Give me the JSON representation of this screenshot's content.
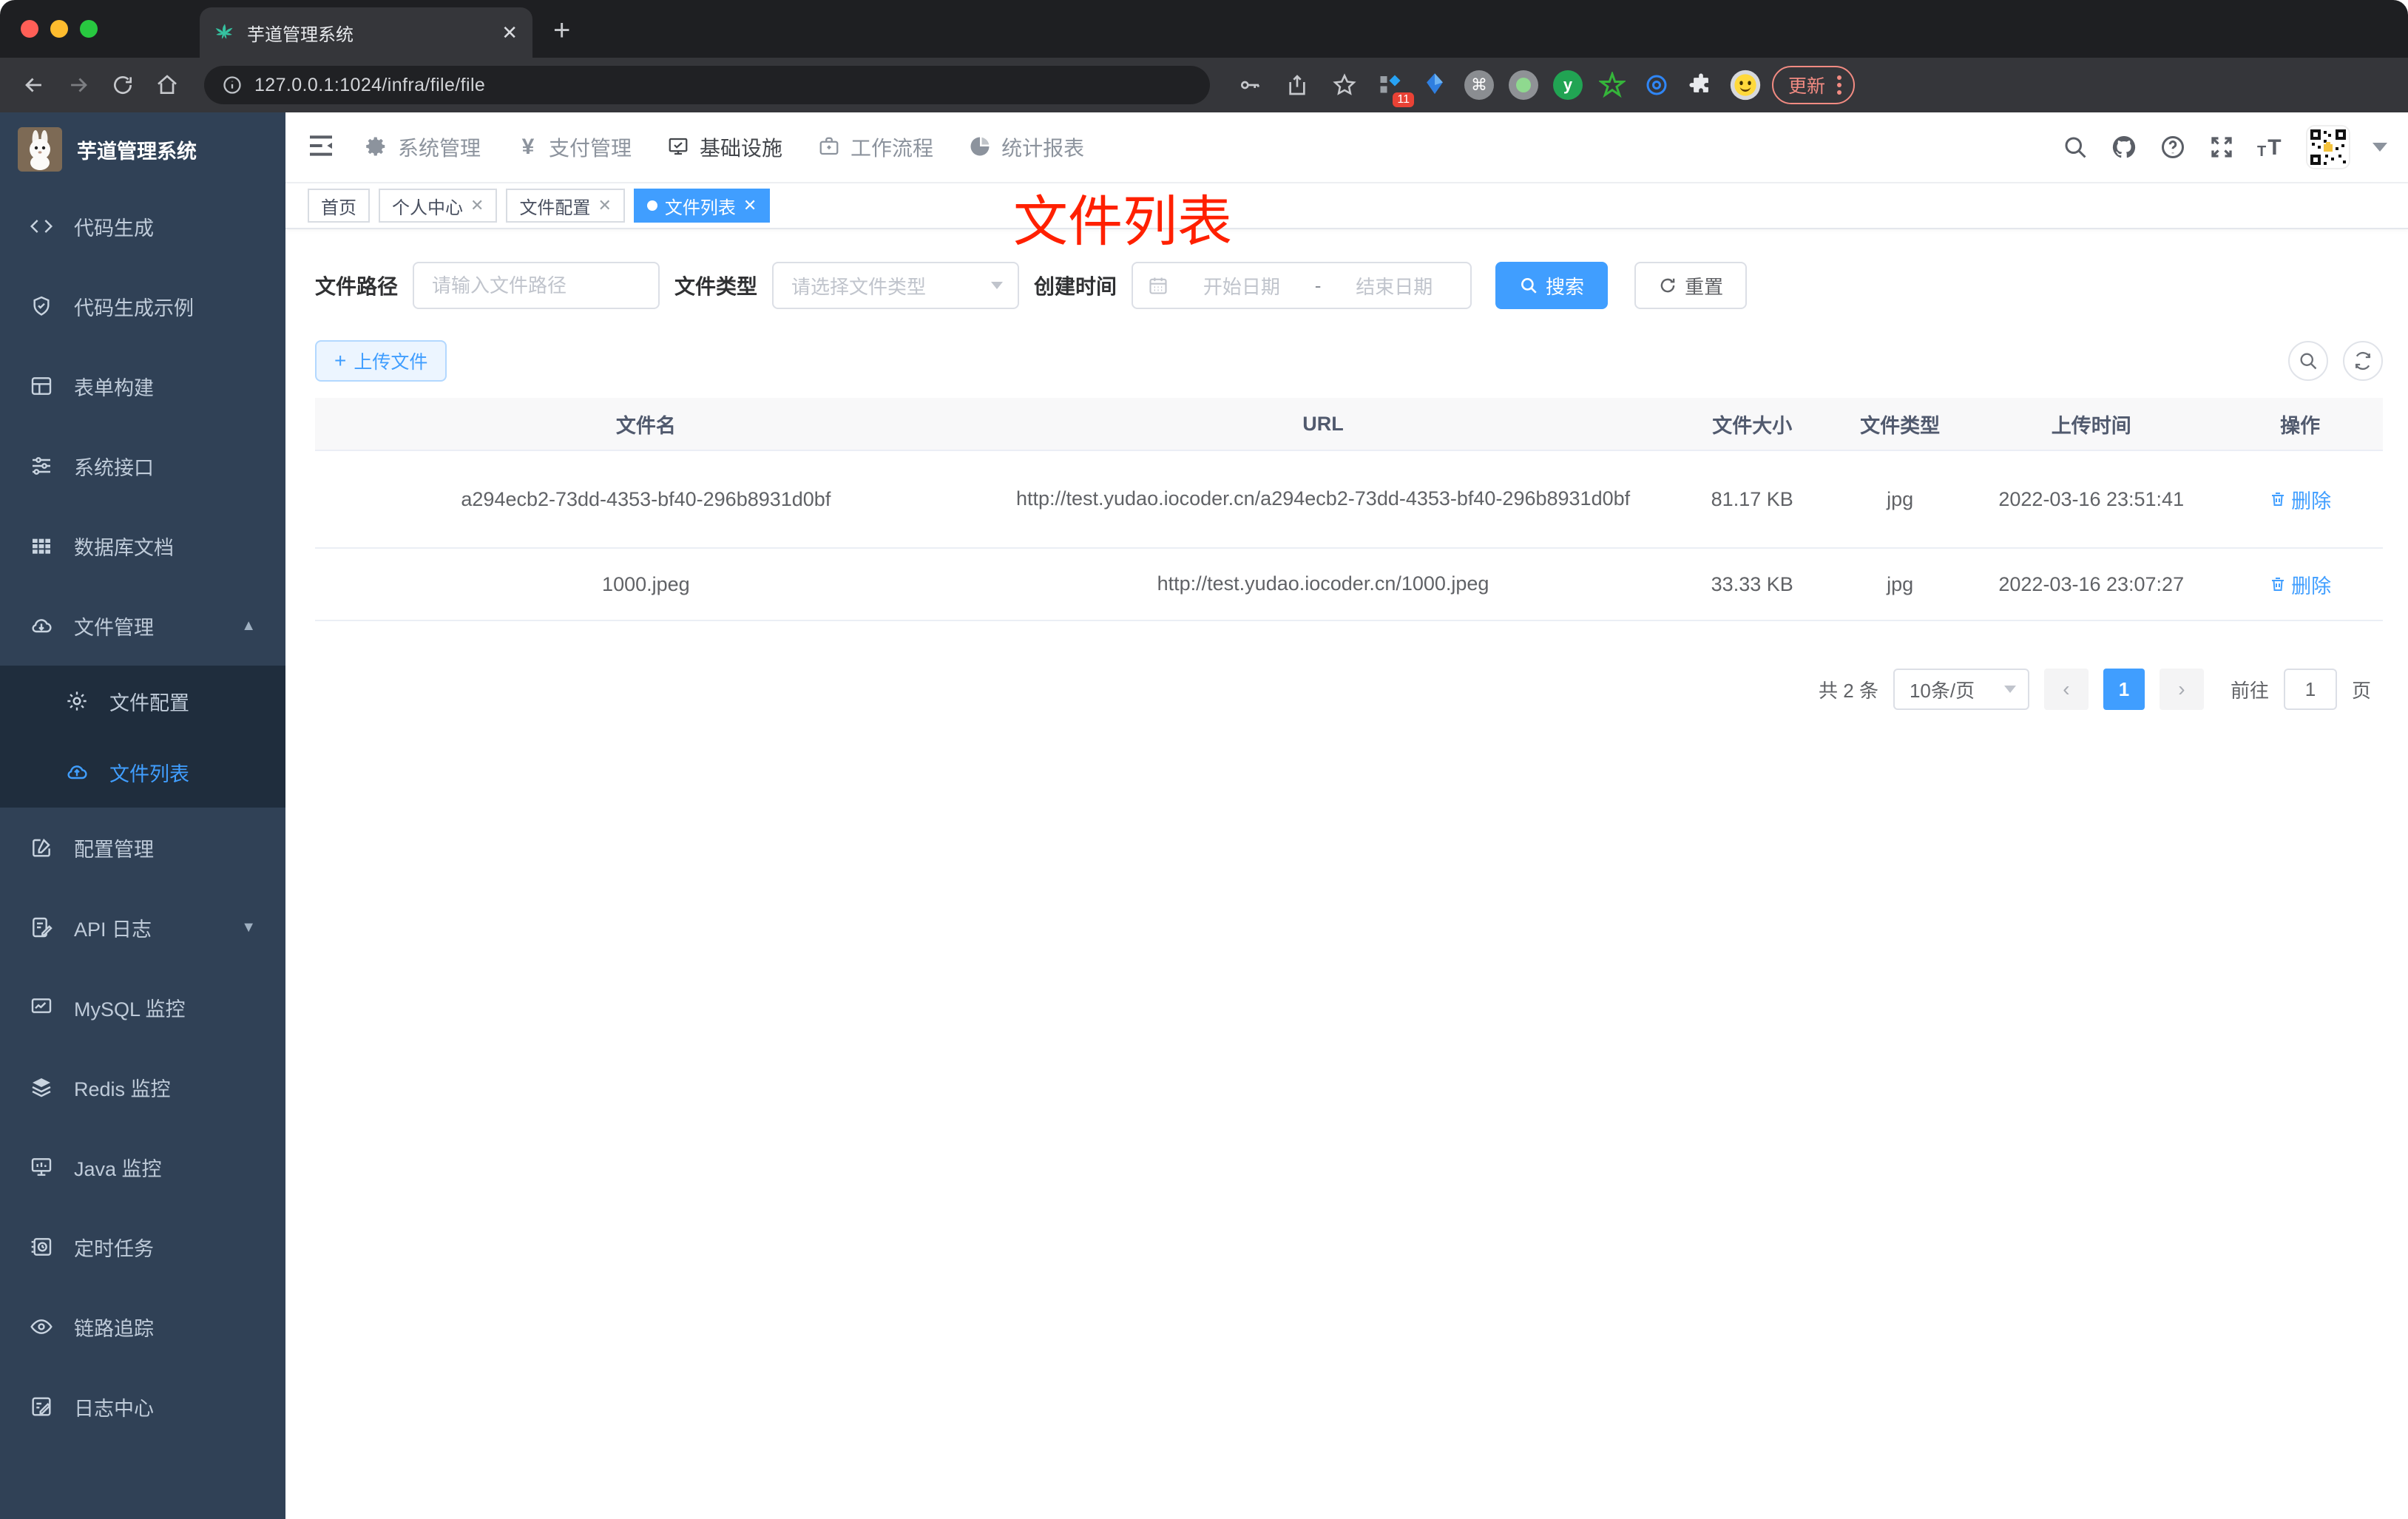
{
  "browser": {
    "tab_title": "芋道管理系统",
    "url": "127.0.0.1:1024/infra/file/file",
    "extension_badge": "11",
    "update_label": "更新"
  },
  "header": {
    "nav": [
      {
        "label": "系统管理"
      },
      {
        "label": "支付管理"
      },
      {
        "label": "基础设施"
      },
      {
        "label": "工作流程"
      },
      {
        "label": "统计报表"
      }
    ]
  },
  "sidebar": {
    "title": "芋道管理系统",
    "items": [
      {
        "label": "代码生成"
      },
      {
        "label": "代码生成示例"
      },
      {
        "label": "表单构建"
      },
      {
        "label": "系统接口"
      },
      {
        "label": "数据库文档"
      },
      {
        "label": "文件管理"
      },
      {
        "label": "文件配置"
      },
      {
        "label": "文件列表"
      },
      {
        "label": "配置管理"
      },
      {
        "label": "API 日志"
      },
      {
        "label": "MySQL 监控"
      },
      {
        "label": "Redis 监控"
      },
      {
        "label": "Java 监控"
      },
      {
        "label": "定时任务"
      },
      {
        "label": "链路追踪"
      },
      {
        "label": "日志中心"
      }
    ]
  },
  "tags": [
    {
      "label": "首页"
    },
    {
      "label": "个人中心"
    },
    {
      "label": "文件配置"
    },
    {
      "label": "文件列表"
    }
  ],
  "annotation": "文件列表",
  "filters": {
    "path_label": "文件路径",
    "path_placeholder": "请输入文件路径",
    "type_label": "文件类型",
    "type_placeholder": "请选择文件类型",
    "date_label": "创建时间",
    "date_start": "开始日期",
    "date_separator": "-",
    "date_end": "结束日期",
    "search_label": "搜索",
    "reset_label": "重置"
  },
  "toolbar": {
    "upload_label": "上传文件"
  },
  "table": {
    "headers": [
      "文件名",
      "URL",
      "文件大小",
      "文件类型",
      "上传时间",
      "操作"
    ],
    "rows": [
      {
        "name": "a294ecb2-73dd-4353-bf40-296b8931d0bf",
        "url": "http://test.yudao.iocoder.cn/a294ecb2-73dd-4353-bf40-296b8931d0bf",
        "size": "81.17 KB",
        "type": "jpg",
        "time": "2022-03-16 23:51:41",
        "action": "删除"
      },
      {
        "name": "1000.jpeg",
        "url": "http://test.yudao.iocoder.cn/1000.jpeg",
        "size": "33.33 KB",
        "type": "jpg",
        "time": "2022-03-16 23:07:27",
        "action": "删除"
      }
    ]
  },
  "pagination": {
    "total": "共 2 条",
    "page_size": "10条/页",
    "prev": "‹",
    "current": "1",
    "next": "›",
    "goto_prefix": "前往",
    "goto_value": "1",
    "goto_suffix": "页"
  },
  "colors": {
    "accent": "#409eff",
    "annotation_red": "#ff2000",
    "sidebar_bg": "#304156",
    "submenu_bg": "#1f2d3d"
  }
}
